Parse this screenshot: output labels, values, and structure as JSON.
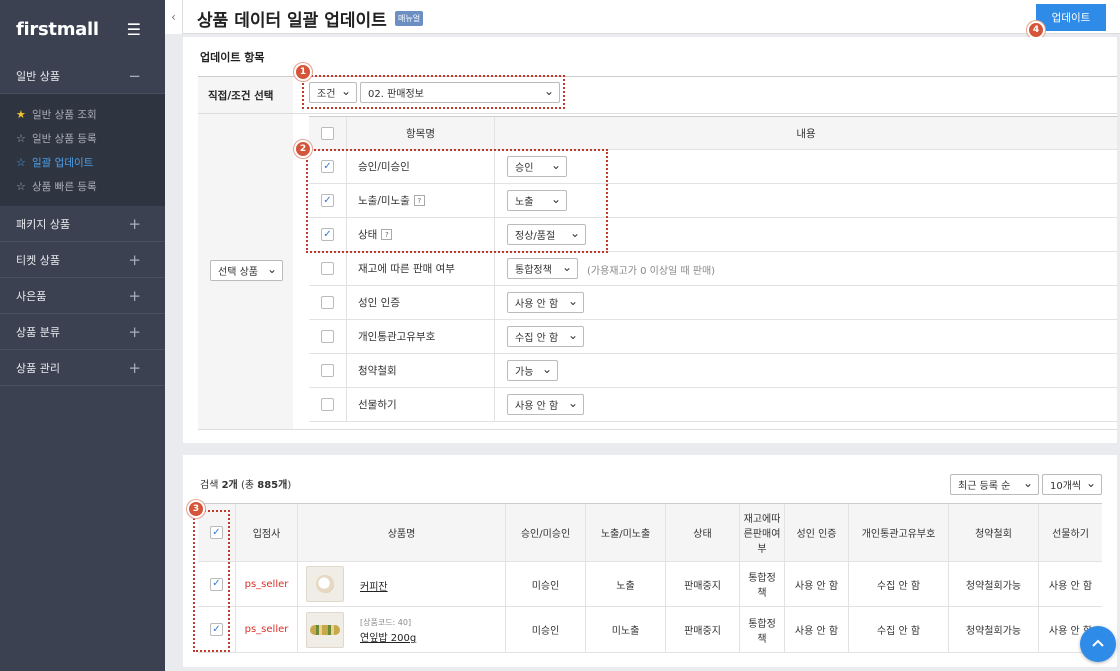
{
  "sidebar": {
    "logo": "firstmall",
    "sections": [
      {
        "label": "일반 상품",
        "sign": "−"
      },
      {
        "label": "패키지 상품",
        "sign": "+"
      },
      {
        "label": "티켓 상품",
        "sign": "+"
      },
      {
        "label": "사은품",
        "sign": "+"
      },
      {
        "label": "상품 분류",
        "sign": "+"
      },
      {
        "label": "상품 관리",
        "sign": "+"
      }
    ],
    "sub_items": [
      "일반 상품 조회",
      "일반 상품 등록",
      "일괄 업데이트",
      "상품 빠른 등록"
    ]
  },
  "header": {
    "title": "상품 데이터 일괄 업데이트",
    "badge": "매뉴얼",
    "update_button": "업데이트"
  },
  "update_section": {
    "title": "업데이트 항목",
    "direct_label": "직접/조건 선택",
    "condition_select": "조건",
    "info_select": "02. 판매정보",
    "target_select": "선택 상품",
    "col_item": "항목명",
    "col_content": "내용",
    "rows": [
      {
        "name": "승인/미승인",
        "checked": true,
        "value": "승인",
        "help": ""
      },
      {
        "name": "노출/미노출",
        "checked": true,
        "value": "노출",
        "help": "?"
      },
      {
        "name": "상태",
        "checked": true,
        "value": "정상/품절",
        "help": "?"
      },
      {
        "name": "재고에 따른 판매 여부",
        "checked": false,
        "value": "통합정책",
        "help": "",
        "hint": "(가용재고가 0 이상일 때 판매)"
      },
      {
        "name": "성인 인증",
        "checked": false,
        "value": "사용 안 함",
        "help": ""
      },
      {
        "name": "개인통관고유부호",
        "checked": false,
        "value": "수집 안 함",
        "help": ""
      },
      {
        "name": "청약철회",
        "checked": false,
        "value": "가능",
        "help": ""
      },
      {
        "name": "선물하기",
        "checked": false,
        "value": "사용 안 함",
        "help": ""
      }
    ]
  },
  "markers": [
    "1",
    "2",
    "3",
    "4"
  ],
  "results": {
    "count_prefix": "검색 ",
    "count_bold": "2개",
    "count_suffix": " (총 ",
    "total_bold": "885개",
    "total_suffix": ")",
    "sort_select": "최근 등록 순",
    "per_page_select": "10개씩",
    "columns": [
      "입점사",
      "상품명",
      "승인/미승인",
      "노출/미노출",
      "상태",
      "재고에따른판매여부",
      "성인 인증",
      "개인통관고유부호",
      "청약철회",
      "선물하기"
    ],
    "rows": [
      {
        "seller": "ps_seller",
        "code": "",
        "name": "커피잔",
        "approval": "미승인",
        "display": "노출",
        "status": "판매중지",
        "stock": "통합정책",
        "adult": "사용 안 함",
        "customs": "수집 안 함",
        "withdraw": "청약철회가능",
        "gift": "사용 안 함"
      },
      {
        "seller": "ps_seller",
        "code": "[상품코드: 40]",
        "name": "연잎밥 200g",
        "approval": "미승인",
        "display": "미노출",
        "status": "판매중지",
        "stock": "통합정책",
        "adult": "사용 안 함",
        "customs": "수집 안 함",
        "withdraw": "청약철회가능",
        "gift": "사용 안 함"
      }
    ]
  },
  "scroll_top_icon": "arrow-up-icon"
}
